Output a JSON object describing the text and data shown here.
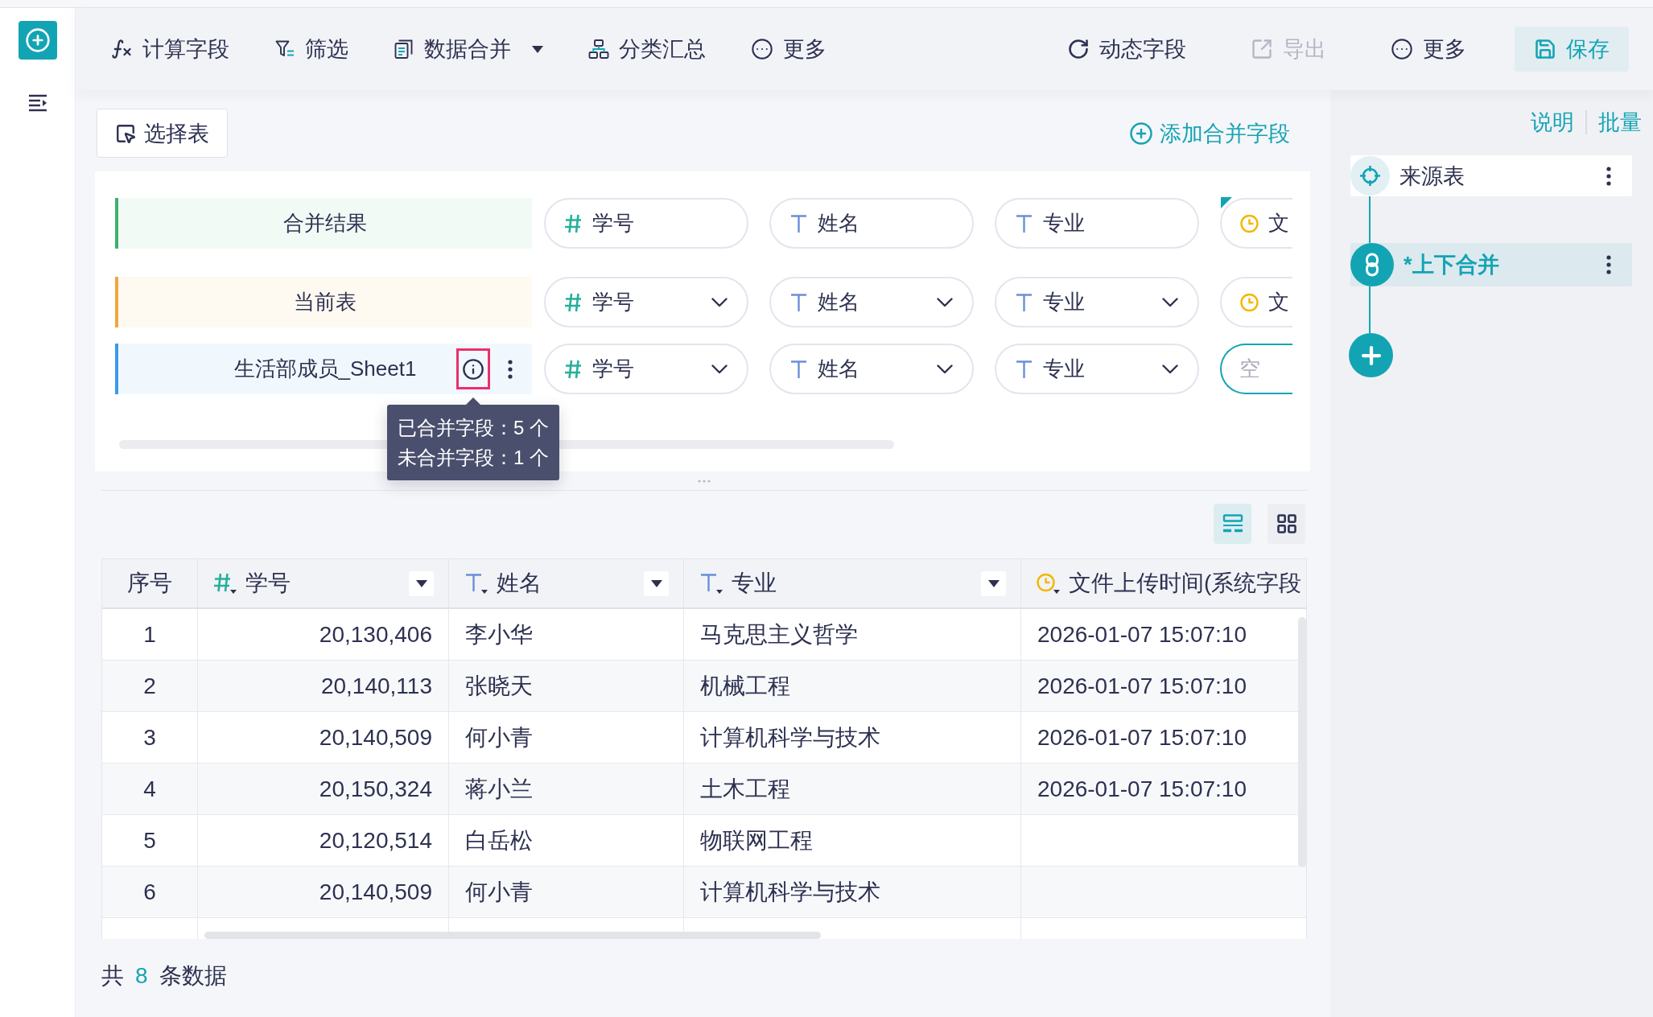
{
  "toolbar": {
    "left_actions": [
      {
        "kind": "formula",
        "label": "计算字段",
        "dropdown": false,
        "disabled": false
      },
      {
        "kind": "filter",
        "label": "筛选",
        "dropdown": false,
        "disabled": false
      },
      {
        "kind": "merge",
        "label": "数据合并",
        "dropdown": true,
        "disabled": false
      },
      {
        "kind": "group",
        "label": "分类汇总",
        "dropdown": false,
        "disabled": false
      },
      {
        "kind": "more",
        "label": "更多",
        "dropdown": false,
        "disabled": false
      }
    ],
    "right_actions": [
      {
        "kind": "dynamic",
        "label": "动态字段",
        "disabled": false
      },
      {
        "kind": "export",
        "label": "导出",
        "disabled": true
      },
      {
        "kind": "more",
        "label": "更多",
        "disabled": false
      },
      {
        "kind": "save",
        "label": "保存",
        "disabled": false
      }
    ]
  },
  "merge_panel": {
    "select_table_button": "选择表",
    "add_field_link": "添加合并字段",
    "rows": [
      {
        "label": "合并结果",
        "color": "#3bb26c",
        "menu": false,
        "fields": [
          {
            "kind": "number",
            "label": "学号",
            "dropdown": false,
            "corner_mark": false
          },
          {
            "kind": "text",
            "label": "姓名",
            "dropdown": false,
            "corner_mark": false
          },
          {
            "kind": "text",
            "label": "专业",
            "dropdown": false,
            "corner_mark": false
          },
          {
            "kind": "time",
            "label": "文",
            "dropdown": false,
            "corner_mark": true
          }
        ]
      },
      {
        "label": "当前表",
        "color": "#f0a83c",
        "menu": false,
        "fields": [
          {
            "kind": "number",
            "label": "学号",
            "dropdown": true,
            "corner_mark": false
          },
          {
            "kind": "text",
            "label": "姓名",
            "dropdown": true,
            "corner_mark": false
          },
          {
            "kind": "text",
            "label": "专业",
            "dropdown": true,
            "corner_mark": false
          },
          {
            "kind": "time",
            "label": "文",
            "dropdown": false,
            "corner_mark": false
          }
        ]
      },
      {
        "label": "生活部成员_Sheet1",
        "color": "#3a9be8",
        "menu": true,
        "info": {
          "highlighted": true,
          "tooltip": [
            "已合并字段：5 个",
            "未合并字段：1 个"
          ]
        },
        "fields": [
          {
            "kind": "number",
            "label": "学号",
            "dropdown": true,
            "corner_mark": false
          },
          {
            "kind": "text",
            "label": "姓名",
            "dropdown": true,
            "corner_mark": false
          },
          {
            "kind": "text",
            "label": "专业",
            "dropdown": true,
            "corner_mark": false
          },
          {
            "kind": "input",
            "placeholder": "空"
          }
        ]
      }
    ]
  },
  "view_toggle": [
    {
      "kind": "rows",
      "selected": true
    },
    {
      "kind": "grid",
      "selected": false
    }
  ],
  "table": {
    "columns": [
      {
        "kind": "index",
        "label": "序号",
        "filter": false
      },
      {
        "kind": "number",
        "label": "学号",
        "filter": true
      },
      {
        "kind": "text",
        "label": "姓名",
        "filter": true
      },
      {
        "kind": "text",
        "label": "专业",
        "filter": true
      },
      {
        "kind": "time",
        "label": "文件上传时间(系统字段",
        "filter": false
      }
    ],
    "rows": [
      [
        "1",
        "20,130,406",
        "李小华",
        "马克思主义哲学",
        "2026-01-07 15:07:10"
      ],
      [
        "2",
        "20,140,113",
        "张晓天",
        "机械工程",
        "2026-01-07 15:07:10"
      ],
      [
        "3",
        "20,140,509",
        "何小青",
        "计算机科学与技术",
        "2026-01-07 15:07:10"
      ],
      [
        "4",
        "20,150,324",
        "蒋小兰",
        "土木工程",
        "2026-01-07 15:07:10"
      ],
      [
        "5",
        "20,120,514",
        "白岳松",
        "物联网工程"
      ],
      [
        "6",
        "20,140,509",
        "何小青",
        "计算机科学与技术"
      ]
    ]
  },
  "summary": {
    "prefix": "共",
    "count": "8",
    "suffix": "条数据"
  },
  "side_panel": {
    "links": [
      "说明",
      "批量"
    ],
    "steps": [
      {
        "kind": "source",
        "label": "来源表",
        "selected": false
      },
      {
        "kind": "merge",
        "label": "*上下合并",
        "selected": true
      }
    ]
  }
}
